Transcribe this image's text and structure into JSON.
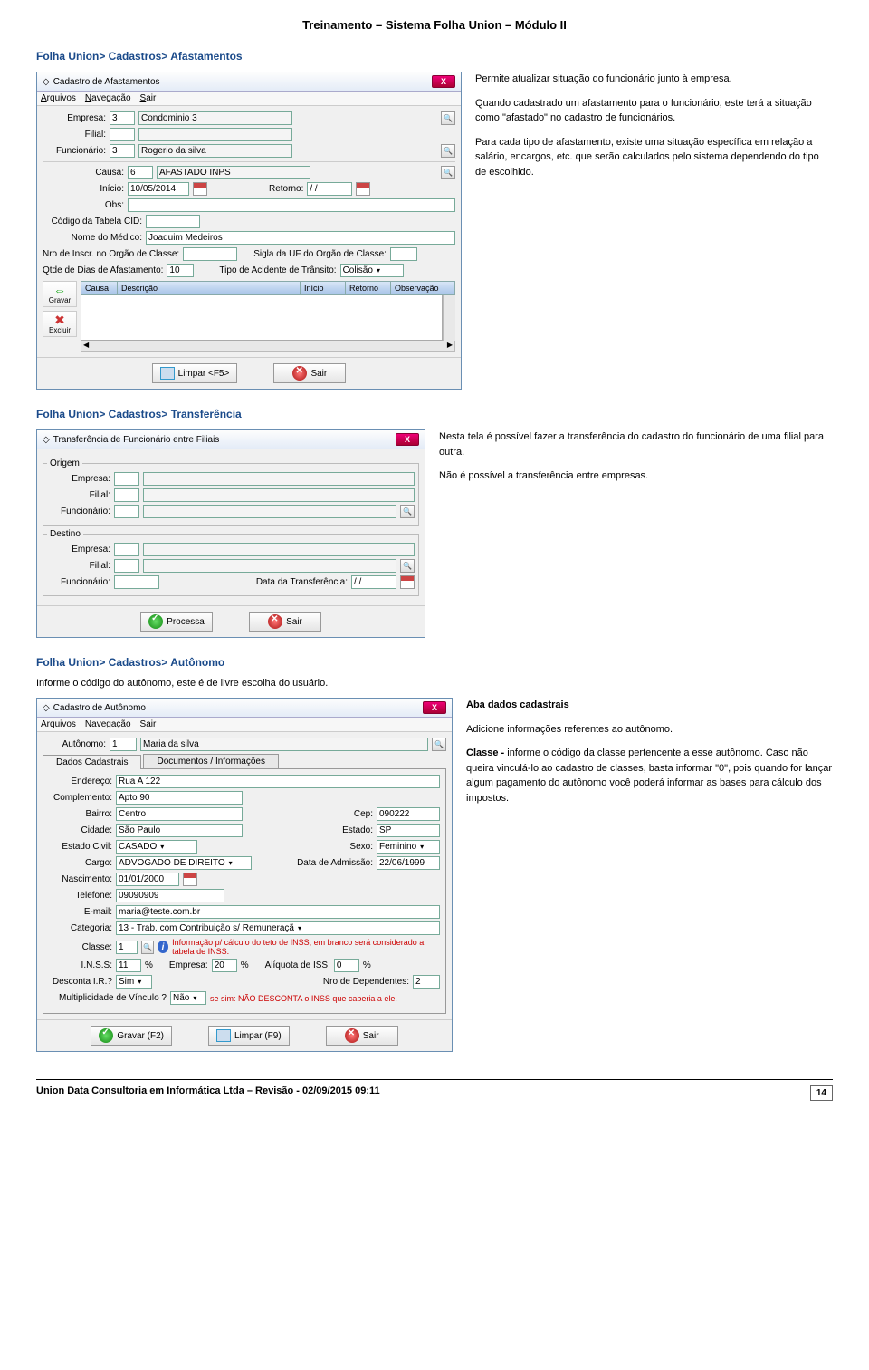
{
  "doc": {
    "header": "Treinamento – Sistema Folha Union – Módulo II",
    "footer": "Union Data Consultoria em Informática Ltda – Revisão - 02/09/2015 09:11",
    "page": "14"
  },
  "sec1": {
    "title": "Folha Union> Cadastros> Afastamentos",
    "win_title": "Cadastro de Afastamentos",
    "menu": {
      "arquivos": "Arquivos",
      "navegacao": "Navegação",
      "sair": "Sair"
    },
    "labels": {
      "empresa": "Empresa:",
      "filial": "Filial:",
      "funcionario": "Funcionário:",
      "causa": "Causa:",
      "inicio": "Início:",
      "retorno": "Retorno:",
      "obs": "Obs:",
      "cid": "Código da Tabela CID:",
      "medico": "Nome do Médico:",
      "nroinscr": "Nro de Inscr. no Orgão de Classe:",
      "sigla": "Sigla da UF do Orgão de Classe:",
      "qtde": "Qtde de Dias de Afastamento:",
      "tipoac": "Tipo de Acidente de Trânsito:"
    },
    "vals": {
      "empresa": "3",
      "empresa_nome": "Condominio 3",
      "filial": "",
      "funcionario": "3",
      "funcionario_nome": "Rogerio da silva",
      "causa": "6",
      "causa_nome": "AFASTADO INPS",
      "inicio": "10/05/2014",
      "retorno": "/ /",
      "obs": "",
      "cid": "",
      "medico": "Joaquim Medeiros",
      "nroinscr": "",
      "sigla": "",
      "qtde": "10",
      "tipoac": "Colisão"
    },
    "grid": {
      "c1": "Causa",
      "c2": "Descrição",
      "c3": "Início",
      "c4": "Retorno",
      "c5": "Observação"
    },
    "side": {
      "gravar": "Gravar",
      "excluir": "Excluir"
    },
    "btns": {
      "limpar": "Limpar <F5>",
      "sair": "Sair"
    },
    "desc": {
      "p1": "Permite atualizar situação do funcionário junto à empresa.",
      "p2": "Quando cadastrado um afastamento para o funcionário, este terá a situação como \"afastado\" no cadastro de funcionários.",
      "p3": "Para cada tipo de afastamento, existe uma situação específica em relação a salário, encargos, etc. que serão calculados pelo sistema dependendo do tipo de escolhido."
    }
  },
  "sec2": {
    "title": "Folha Union> Cadastros> Transferência",
    "win_title": "Transferência de Funcionário entre Filiais",
    "legends": {
      "origem": "Origem",
      "destino": "Destino"
    },
    "labels": {
      "empresa": "Empresa:",
      "filial": "Filial:",
      "funcionario": "Funcionário:",
      "data": "Data da Transferência:"
    },
    "vals": {
      "data": "/ /"
    },
    "btns": {
      "processa": "Processa",
      "sair": "Sair"
    },
    "desc": {
      "p1": "Nesta tela é possível fazer a transferência do cadastro do funcionário de uma filial para outra.",
      "p2": "Não é possível a transferência entre empresas."
    }
  },
  "sec3": {
    "title": "Folha Union> Cadastros> Autônomo",
    "intro": "Informe o código do autônomo, este é de livre escolha do usuário.",
    "win_title": "Cadastro de Autônomo",
    "menu": {
      "arquivos": "Arquivos",
      "navegacao": "Navegação",
      "sair": "Sair"
    },
    "tabs": {
      "t1": "Dados Cadastrais",
      "t2": "Documentos / Informações"
    },
    "labels": {
      "autonomo": "Autônomo:",
      "endereco": "Endereço:",
      "complemento": "Complemento:",
      "bairro": "Bairro:",
      "cep": "Cep:",
      "cidade": "Cidade:",
      "estado": "Estado:",
      "estcivil": "Estado Civil:",
      "sexo": "Sexo:",
      "cargo": "Cargo:",
      "dataadm": "Data de Admissão:",
      "nascimento": "Nascimento:",
      "telefone": "Telefone:",
      "email": "E-mail:",
      "categoria": "Categoria:",
      "classe": "Classe:",
      "inss": "I.N.S.S:",
      "pct": "%",
      "empresapct": "Empresa:",
      "aliqiss": "Alíquota de ISS:",
      "descir": "Desconta I.R.?",
      "nrodep": "Nro de Dependentes:",
      "multvinc": "Multiplicidade de Vínculo ?"
    },
    "vals": {
      "autonomo": "1",
      "autonomo_nome": "Maria da silva",
      "endereco": "Rua A 122",
      "complemento": "Apto 90",
      "bairro": "Centro",
      "cep": "090222",
      "cidade": "São Paulo",
      "estado": "SP",
      "estcivil": "CASADO",
      "sexo": "Feminino",
      "cargo": "ADVOGADO DE DIREITO",
      "dataadm": "22/06/1999",
      "nascimento": "01/01/2000",
      "telefone": "09090909",
      "email": "maria@teste.com.br",
      "categoria": "13 - Trab. com Contribuição s/ Remuneraçã",
      "classe": "1",
      "inss": "11",
      "empresapct": "20",
      "aliqiss": "0",
      "descir": "Sim",
      "nrodep": "2",
      "multvinc": "Não"
    },
    "info1": "Informação p/ cálculo do teto de INSS, em branco será considerado a tabela de INSS.",
    "info2": "se sim: NÃO DESCONTA o INSS que caberia a ele.",
    "btns": {
      "gravar": "Gravar (F2)",
      "limpar": "Limpar (F9)",
      "sair": "Sair"
    },
    "desc": {
      "h": "Aba dados cadastrais",
      "p1": "Adicione informações referentes ao autônomo.",
      "p2a": "Classe -",
      "p2b": " informe o código da classe pertencente a esse autônomo. Caso não queira vinculá-lo ao cadastro de classes, basta informar \"0\", pois quando for lançar algum pagamento do autônomo você poderá informar as bases para cálculo dos impostos."
    }
  }
}
